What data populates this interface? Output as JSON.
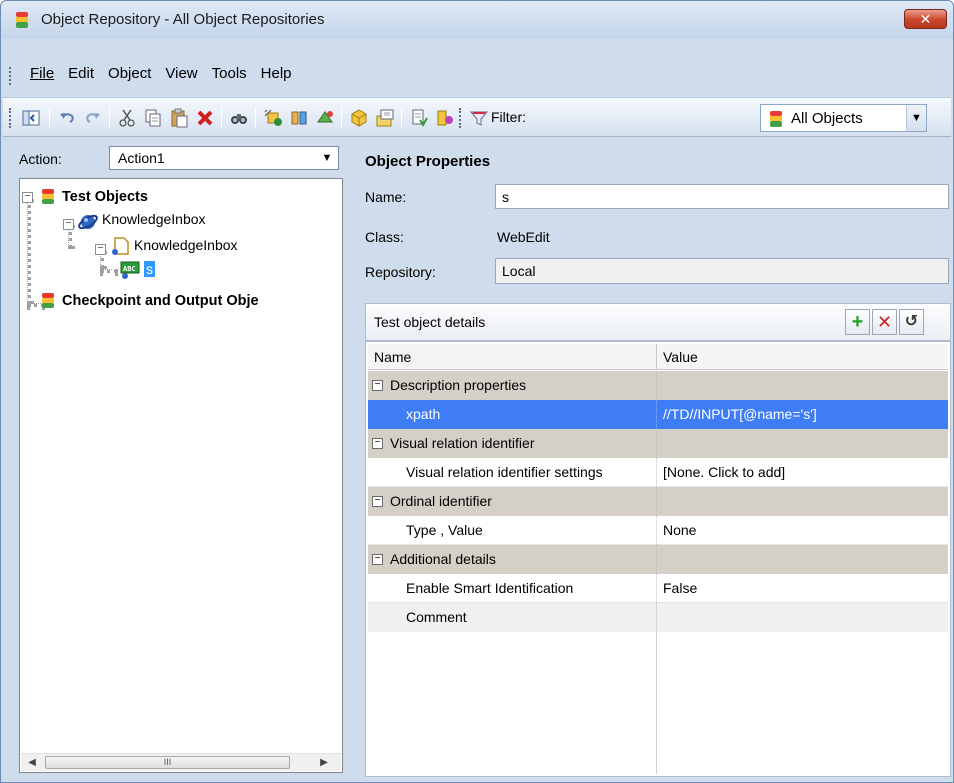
{
  "window": {
    "title": "Object Repository - All Object Repositories",
    "close_glyph": "✕"
  },
  "menu": {
    "items": [
      "File",
      "Edit",
      "Object",
      "View",
      "Tools",
      "Help"
    ]
  },
  "toolbar": {
    "filter_label": "Filter:",
    "filter_value": "All Objects"
  },
  "action": {
    "label": "Action:",
    "value": "Action1"
  },
  "tree": {
    "root": "Test Objects",
    "browser": "KnowledgeInbox",
    "page": "KnowledgeInbox",
    "edit": "s",
    "checkpoint": "Checkpoint and Output Obje",
    "scroll_thumb_glyph": "III"
  },
  "properties": {
    "title": "Object Properties",
    "name_label": "Name:",
    "name_value": "s",
    "class_label": "Class:",
    "class_value": "WebEdit",
    "repository_label": "Repository:",
    "repository_value": "Local"
  },
  "details": {
    "title": "Test object details",
    "columns": [
      "Name",
      "Value"
    ],
    "rows": [
      {
        "type": "category",
        "name": "Description properties",
        "value": ""
      },
      {
        "type": "selected",
        "name": "xpath",
        "value": "//TD//INPUT[@name='s']"
      },
      {
        "type": "category",
        "name": "Visual relation identifier",
        "value": ""
      },
      {
        "type": "prop",
        "name": "Visual relation identifier settings",
        "value": "[None. Click to add]"
      },
      {
        "type": "category",
        "name": "Ordinal identifier",
        "value": ""
      },
      {
        "type": "prop",
        "name": "Type , Value",
        "value": "None"
      },
      {
        "type": "category",
        "name": "Additional details",
        "value": ""
      },
      {
        "type": "prop",
        "name": "Enable Smart Identification",
        "value": "False"
      },
      {
        "type": "prop-alt",
        "name": "Comment",
        "value": ""
      }
    ]
  },
  "colors": {
    "selection": "#3f7df6",
    "category_bg": "#d4d0c8",
    "chrome": "#cfdcec"
  }
}
